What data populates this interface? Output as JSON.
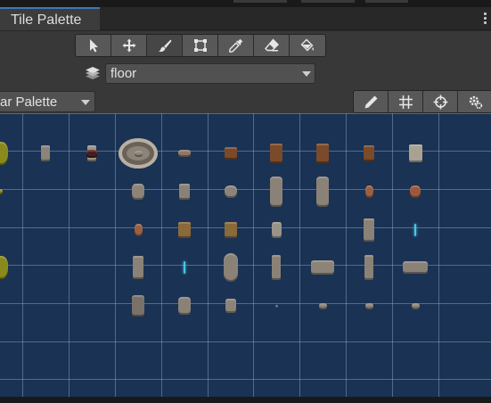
{
  "window": {
    "tab_title": "Tile Palette"
  },
  "toolbar": {
    "tools": [
      {
        "name": "select-tool",
        "icon": "arrow-cursor-icon",
        "active": false
      },
      {
        "name": "move-tool",
        "icon": "move-arrows-icon",
        "active": false
      },
      {
        "name": "paint-tool",
        "icon": "paintbrush-icon",
        "active": true
      },
      {
        "name": "box-fill-tool",
        "icon": "box-select-icon",
        "active": false
      },
      {
        "name": "picker-tool",
        "icon": "eyedropper-icon",
        "active": false
      },
      {
        "name": "erase-tool",
        "icon": "eraser-icon",
        "active": false
      },
      {
        "name": "flood-fill-tool",
        "icon": "paint-bucket-icon",
        "active": false
      }
    ]
  },
  "active_tilemap": {
    "icon": "layers-icon",
    "value": "floor"
  },
  "palette_selector": {
    "value": "ar Palette"
  },
  "palette_tools": [
    {
      "name": "edit-palette",
      "icon": "pencil-icon"
    },
    {
      "name": "toggle-grid",
      "icon": "grid-icon"
    },
    {
      "name": "toggle-gizmos",
      "icon": "gizmo-icon"
    },
    {
      "name": "palette-settings",
      "icon": "gear-icon"
    }
  ],
  "colors": {
    "accent": "#3a79bb",
    "grid_background": "#1a3253",
    "grid_lines": "#96afd7",
    "stone": "#8c8478",
    "wood": "#7a4a2a",
    "moss": "#8a8a1c"
  },
  "tiles": [
    {
      "col": 0,
      "row": 1,
      "kind": "moss-edge"
    },
    {
      "col": 1,
      "row": 1,
      "kind": "stone-pillar"
    },
    {
      "col": 2,
      "row": 1,
      "kind": "stone-slab"
    },
    {
      "col": 3,
      "row": 1,
      "kind": "stone-circle"
    },
    {
      "col": 4,
      "row": 1,
      "kind": "pebble-tiny"
    },
    {
      "col": 5,
      "row": 1,
      "kind": "pebble-tiny"
    },
    {
      "col": 6,
      "row": 1,
      "kind": "pebble-tiny"
    },
    {
      "col": 7,
      "row": 1,
      "kind": "pebble-tiny"
    },
    {
      "col": 8,
      "row": 1,
      "kind": "wood-shield"
    },
    {
      "col": 9,
      "row": 1,
      "kind": "rock-small"
    },
    {
      "col": 1,
      "row": 2,
      "kind": "stone-pillar"
    },
    {
      "col": 2,
      "row": 2,
      "kind": "dark-leaf"
    },
    {
      "col": 3,
      "row": 2,
      "kind": "rock-small"
    },
    {
      "col": 4,
      "row": 2,
      "kind": "rock-pair"
    },
    {
      "col": 5,
      "row": 2,
      "kind": "wood-crate"
    },
    {
      "col": 6,
      "row": 2,
      "kind": "wood-cabinet"
    },
    {
      "col": 7,
      "row": 2,
      "kind": "wood-cabinet"
    },
    {
      "col": 8,
      "row": 2,
      "kind": "wood-door"
    },
    {
      "col": 9,
      "row": 2,
      "kind": "stone-block"
    },
    {
      "col": 0,
      "row": 3,
      "kind": "moss-edge-small"
    },
    {
      "col": 3,
      "row": 3,
      "kind": "stone-urn"
    },
    {
      "col": 4,
      "row": 3,
      "kind": "stone-cross"
    },
    {
      "col": 5,
      "row": 3,
      "kind": "stone-tomb"
    },
    {
      "col": 6,
      "row": 3,
      "kind": "stone-statue-tall"
    },
    {
      "col": 7,
      "row": 3,
      "kind": "stone-statue-tall"
    },
    {
      "col": 8,
      "row": 3,
      "kind": "clay-vase"
    },
    {
      "col": 9,
      "row": 3,
      "kind": "clay-pot"
    },
    {
      "col": 3,
      "row": 4,
      "kind": "clay-vase"
    },
    {
      "col": 4,
      "row": 4,
      "kind": "wood-signpost"
    },
    {
      "col": 5,
      "row": 4,
      "kind": "wood-signpost"
    },
    {
      "col": 6,
      "row": 4,
      "kind": "stone-tablet"
    },
    {
      "col": 8,
      "row": 4,
      "kind": "stone-column"
    },
    {
      "col": 9,
      "row": 4,
      "kind": "water-drip"
    },
    {
      "col": 0,
      "row": 5,
      "kind": "moss-edge"
    },
    {
      "col": 3,
      "row": 5,
      "kind": "stone-column"
    },
    {
      "col": 4,
      "row": 5,
      "kind": "water-drip"
    },
    {
      "col": 5,
      "row": 5,
      "kind": "stone-statue"
    },
    {
      "col": 6,
      "row": 5,
      "kind": "stone-bracket"
    },
    {
      "col": 7,
      "row": 5,
      "kind": "stone-bench"
    },
    {
      "col": 8,
      "row": 5,
      "kind": "stone-bracket"
    },
    {
      "col": 9,
      "row": 5,
      "kind": "stone-coffin"
    },
    {
      "col": 3,
      "row": 6,
      "kind": "stone-shrine"
    },
    {
      "col": 4,
      "row": 6,
      "kind": "stone-barrel"
    },
    {
      "col": 5,
      "row": 6,
      "kind": "stone-urn-small"
    },
    {
      "col": 6,
      "row": 6,
      "kind": "pebble-tiny"
    },
    {
      "col": 7,
      "row": 6,
      "kind": "rock-small"
    },
    {
      "col": 8,
      "row": 6,
      "kind": "rock-small"
    },
    {
      "col": 9,
      "row": 6,
      "kind": "rock-small"
    }
  ]
}
